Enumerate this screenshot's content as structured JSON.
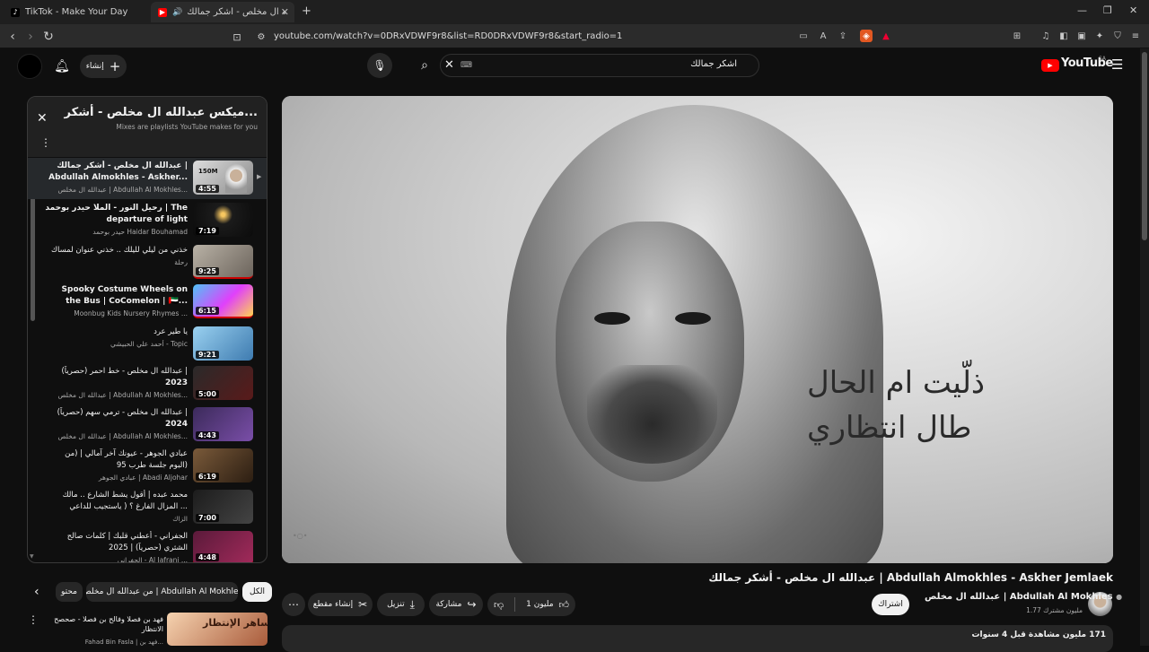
{
  "browser": {
    "tabs": [
      {
        "title": "TikTok - Make Your Day"
      },
      {
        "title": "عبدالله ال مخلص - أشكر جمالك"
      }
    ],
    "url": "youtube.com/watch?v=0DRxVDWF9r8&list=RD0DRxVDWF9r8&start_radio=1"
  },
  "yt": {
    "logo": "YouTube",
    "logo_region": "SA",
    "search_value": "اشكر جمالك",
    "create_label": "إنشاء"
  },
  "playlist": {
    "title": "ميكس عبدالله ال مخلص - أشكر...",
    "subtitle": "Mixes are playlists YouTube makes for you",
    "items": [
      {
        "line1": "عبدالله ال مخلص - أشكر جمالك |",
        "line2": "Abdullah Almokhles - Askher...",
        "channel": "عبدالله ال مخلص | Abdullah Al Mokhles...",
        "duration": "4:55",
        "views_badge": "150M"
      },
      {
        "line1": "رحيل النور - الملا حيدر بوحمد | The",
        "line2": "departure of light",
        "channel": "حيدر بوحمد Haidar Bouhamad",
        "duration": "7:19"
      },
      {
        "line1": "خذني من ليلي لليلك .. خذني عنوان لمساك",
        "line2": "",
        "channel": "رحلة",
        "duration": "9:25"
      },
      {
        "line1": "Spooky Costume Wheels on",
        "line2": "the Bus | CoComelon | 🇦🇪...",
        "channel": "Moonbug Kids Nursery Rhymes ...",
        "duration": "6:15"
      },
      {
        "line1": "يا طير عرد",
        "line2": "",
        "channel": "أحمد علي الحبيشي - Topic",
        "duration": "9:21"
      },
      {
        "line1": "عبدالله ال مخلص - خط احمر (حصرياً) |",
        "line2": "2023",
        "channel": "عبدالله ال مخلص | Abdullah Al Mokhles...",
        "duration": "5:00"
      },
      {
        "line1": "عبدالله ال مخلص - ترمي سهم (حصرياً) |",
        "line2": "2024",
        "channel": "عبدالله ال مخلص | Abdullah Al Mokhles...",
        "duration": "4:43"
      },
      {
        "line1": "عبادي الجوهر - عيونك آخر آمالي | (من",
        "line2": "البوم جلسة طرب 95)",
        "channel": "عبادي الجوهر | Abadi Aljohar",
        "duration": "6:19"
      },
      {
        "line1": "محمد عبده | أقول يشط الشارع .. مالك",
        "line2": "المزال الفارغ ؟ ( ياستجيب للداعي ...",
        "channel": "الزاك",
        "duration": "7:00"
      },
      {
        "line1": "الجفراني - أعطني قلبك | كلمات صالح",
        "line2": "الشثري (حصرياً) | 2025",
        "channel": "الجفراني - Al Jafrani ...",
        "duration": "4:48"
      }
    ]
  },
  "video": {
    "overlay_line1": "ذلّيت ام الحال",
    "overlay_line2": "طال انتظاري",
    "watermark": "•○•"
  },
  "meta": {
    "title": "عبدالله ال مخلص - أشكر جمالك | Abdullah Almokhles - Askher Jemlaek",
    "channel_name": "عبدالله ال مخلص | Abdullah Al Mokhles",
    "subscribers": "1.77 مليون مشترك",
    "subscribe_label": "اشتراك",
    "like_count": "1 مليون",
    "share_label": "مشاركة",
    "download_label": "تنزيل",
    "clip_label": "إنشاء مقطع",
    "views": "171 مليون مشاهدة",
    "date": "قبل 4 سنوات"
  },
  "chips": {
    "all": "الكل",
    "from_channel": "من عبدالله ال مخلص | Abdullah Al Mokhles",
    "related": "محتو"
  },
  "suggestion": {
    "title": "فهد بن فصلا وفالح بن فصلا - صحصح الانتظار",
    "channel": "Fahad Bin Fasla | فهد بن...",
    "thumb_text": "تساهر الإنتظار"
  }
}
